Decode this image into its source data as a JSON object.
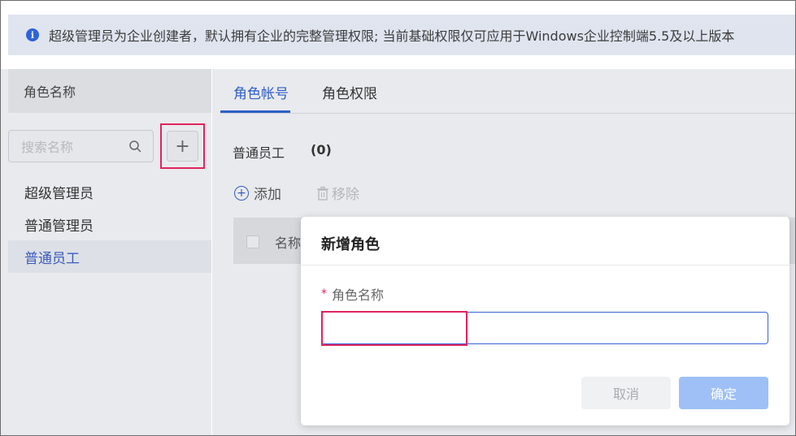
{
  "notice": {
    "icon": "info-icon",
    "text": "超级管理员为企业创建者，默认拥有企业的完整管理权限; 当前基础权限仅可应用于Windows企业控制端5.5及以上版本"
  },
  "sidebar": {
    "header": "角色名称",
    "search": {
      "placeholder": "搜索名称",
      "icon": "search-icon"
    },
    "add_button_label": "+",
    "roles": [
      {
        "label": "超级管理员",
        "active": false
      },
      {
        "label": "普通管理员",
        "active": false
      },
      {
        "label": "普通员工",
        "active": true
      }
    ]
  },
  "main": {
    "tabs": [
      {
        "label": "角色帐号",
        "active": true
      },
      {
        "label": "角色权限",
        "active": false
      }
    ],
    "group": {
      "title": "普通员工",
      "count": "(0)"
    },
    "actions": {
      "add": "添加",
      "remove": "移除"
    },
    "table": {
      "columns": [
        "名称"
      ]
    }
  },
  "modal": {
    "title": "新增角色",
    "field_label": "角色名称",
    "required_mark": "*",
    "input_value": "",
    "cancel": "取消",
    "confirm": "确定"
  },
  "colors": {
    "accent": "#2f5fc7",
    "highlight": "#e0245e",
    "confirm_disabled": "#9ec0f7"
  }
}
